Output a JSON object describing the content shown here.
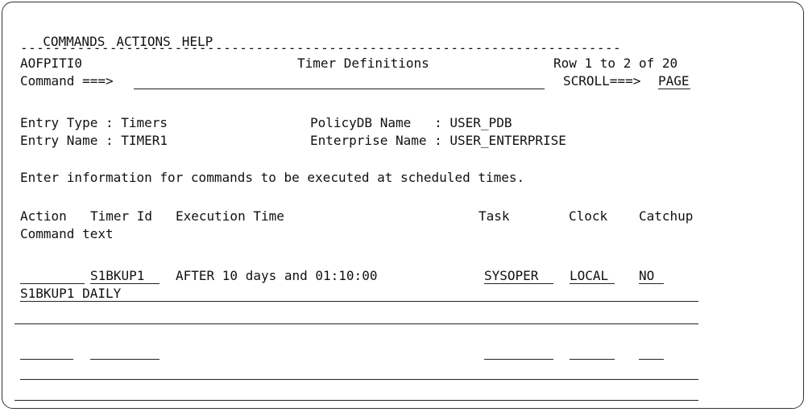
{
  "menu": [
    "COMMANDS",
    "ACTIONS",
    "HELP"
  ],
  "separator": "--------------------------------------------------------------------------",
  "panel": {
    "id": "AOFPITI0",
    "title": "Timer Definitions",
    "row_info": "Row 1 to 2 of 20",
    "command_label": "Command ===>",
    "command_value": "",
    "scroll_label": "SCROLL===>",
    "scroll_value": "PAGE"
  },
  "entry": {
    "type_label": "Entry Type : Timers",
    "name_label": "Entry Name : TIMER1",
    "policydb_label": "PolicyDB Name   : USER_PDB",
    "enterprise_label": "Enterprise Name : USER_ENTERPRISE"
  },
  "instruction": "Enter information for commands to be executed at scheduled times.",
  "columns": {
    "action": "Action",
    "timer_id": "Timer Id",
    "execution_time": "Execution Time",
    "task": "Task",
    "clock": "Clock",
    "catchup": "Catchup",
    "command_text": "Command text"
  },
  "rows": [
    {
      "action": "",
      "timer_id": "S1BKUP1",
      "execution_time": "AFTER 10 days and 01:10:00",
      "task": "SYSOPER",
      "clock": "LOCAL",
      "catchup": "NO",
      "command_text": "S1BKUP1 DAILY"
    },
    {
      "action": "",
      "timer_id": "",
      "execution_time": "",
      "task": "",
      "clock": "",
      "catchup": "",
      "command_text": ""
    }
  ]
}
